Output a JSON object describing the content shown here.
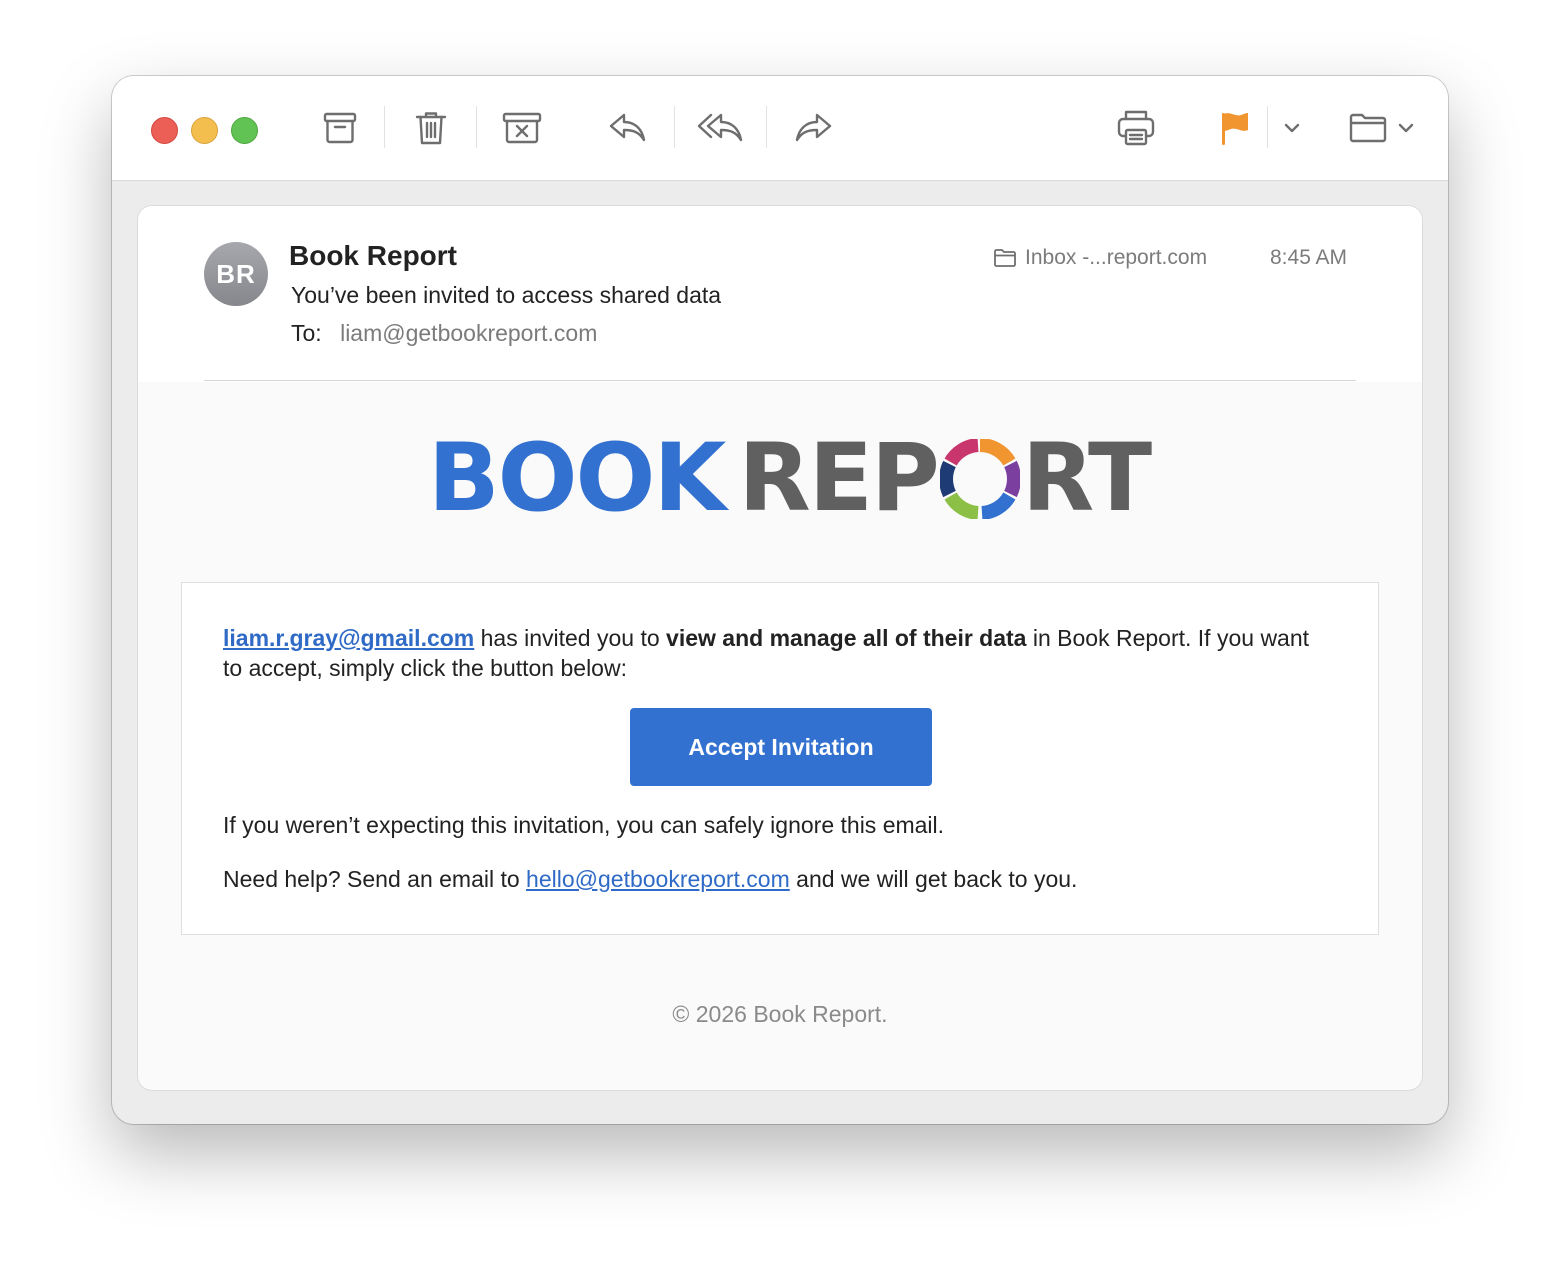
{
  "window": {
    "controls": [
      "close",
      "minimize",
      "zoom"
    ]
  },
  "toolbar": {
    "icons": [
      "archive-icon",
      "trash-icon",
      "junk-icon",
      "reply-icon",
      "reply-all-icon",
      "forward-icon",
      "print-icon",
      "flag-icon",
      "chevron-down-icon",
      "folder-icon",
      "chevron-down-icon"
    ],
    "flag_color": "#f0952f"
  },
  "message": {
    "avatar_initials": "BR",
    "sender": "Book Report",
    "subject": "You’ve been invited to access shared data",
    "to_label": "To:",
    "to_address": "liam@getbookreport.com",
    "mailbox": "Inbox -...report.com",
    "time": "8:45 AM"
  },
  "email_body": {
    "logo": {
      "part1": "BOOK",
      "part2_a": "REP",
      "part2_b": "RT",
      "part1_color": "#3271cf",
      "part2_color": "#606060"
    },
    "inviter_email": "liam.r.gray@gmail.com",
    "invite_text_1": " has invited you to ",
    "invite_bold": "view and manage all of their data",
    "invite_text_2": " in Book Report. If you want to accept, simply click the button below:",
    "accept_button": "Accept Invitation",
    "ignore_text": "If you weren’t expecting this invitation, you can safely ignore this email.",
    "help_text_1": "Need help? Send an email to ",
    "help_email": "hello@getbookreport.com",
    "help_text_2": " and we will get back to you.",
    "footer": "© 2026 Book Report.",
    "accent_color": "#3271cf"
  }
}
